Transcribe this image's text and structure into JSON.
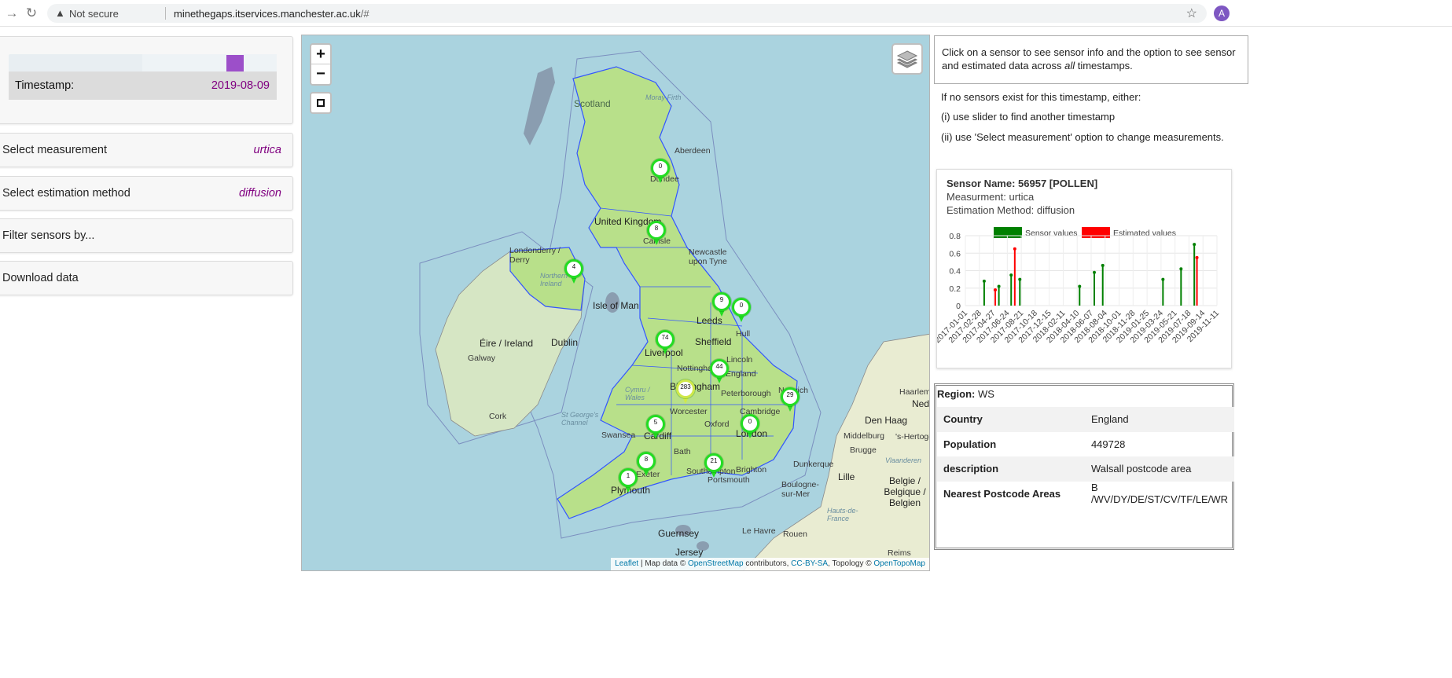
{
  "browser": {
    "security_label": "Not secure",
    "url_host": "minethegaps.itservices.manchester.ac.uk",
    "url_path": "/#",
    "profile_initial": "A"
  },
  "controls": {
    "timestamp_label": "Timestamp:",
    "timestamp_value": "2019-08-09",
    "measurement_label": "Select measurement",
    "measurement_value": "urtica",
    "estimation_label": "Select estimation method",
    "estimation_value": "diffusion",
    "filter_label": "Filter sensors by...",
    "download_label": "Download data",
    "accent_color": "#9c4fc9"
  },
  "map": {
    "zoom_in": "+",
    "zoom_out": "−",
    "attribution": {
      "leaflet": "Leaflet",
      "map_data": " | Map data © ",
      "osm": "OpenStreetMap",
      "contributors": " contributors, ",
      "license": "CC-BY-SA",
      "topology": ", Topology © ",
      "opentopo": "OpenTopoMap"
    },
    "labels": {
      "scotland": "Scotland",
      "moray": "Moray Firth",
      "aberdeen": "Aberdeen",
      "dundee": "Dundee",
      "uk": "United Kingdom",
      "londonderry": "Londonderry / Derry",
      "ni": "Northern Ireland",
      "newcastle": "Newcastle upon Tyne",
      "carlisle": "Carlisle",
      "isle_of_man": "Isle of Man",
      "leeds": "Leeds",
      "hull": "Hull",
      "sheffield": "Sheffield",
      "liverpool": "Liverpool",
      "eire": "Éire / Ireland",
      "dublin": "Dublin",
      "galway": "Galway",
      "nottingham": "Nottingham",
      "lincoln": "Lincoln",
      "birmingham": "Birmingham",
      "peterborough": "Peterborough",
      "cymru": "Cymru / Wales",
      "cork": "Cork",
      "worcester": "Worcester",
      "cambridge": "Cambridge",
      "norwich": "Norwich",
      "stgeorge": "St George's Channel",
      "swansea": "Swansea",
      "cardiff": "Cardiff",
      "oxford": "Oxford",
      "london": "London",
      "bath": "Bath",
      "exeter": "Exeter",
      "southampton": "Southampton",
      "portsmouth": "Portsmouth",
      "brighton": "Brighton",
      "plymouth": "Plymouth",
      "england": "England",
      "haarlem": "Haarlem",
      "nederland": "Nederland",
      "denhaag": "Den Haag",
      "hertogenbosch": "'s-Hertogenbosch",
      "middelburg": "Middelburg",
      "brugge": "Brugge",
      "vlaanderen": "Vlaanderen",
      "dunkerque": "Dunkerque",
      "lille": "Lille",
      "belgie": "Belgie / Belgique / Belgien",
      "boulogne": "Boulogne-sur-Mer",
      "hautsdefrance": "Hauts-de-France",
      "lehavre": "Le Havre",
      "rouen": "Rouen",
      "reims": "Reims",
      "guernsey": "Guernsey",
      "jersey": "Jersey"
    },
    "markers": [
      {
        "count": "0",
        "color": "green"
      },
      {
        "count": "8",
        "color": "green"
      },
      {
        "count": "4",
        "color": "green"
      },
      {
        "count": "9",
        "color": "green"
      },
      {
        "count": "0",
        "color": "green"
      },
      {
        "count": "74",
        "color": "green"
      },
      {
        "count": "44",
        "color": "green"
      },
      {
        "count": "283",
        "color": "yellow"
      },
      {
        "count": "29",
        "color": "green"
      },
      {
        "count": "5",
        "color": "green"
      },
      {
        "count": "0",
        "color": "green"
      },
      {
        "count": "8",
        "color": "green"
      },
      {
        "count": "21",
        "color": "green"
      },
      {
        "count": "1",
        "color": "green"
      }
    ]
  },
  "info": {
    "intro_pre": "Click on a sensor to see sensor info and the option to see sensor and estimated data across ",
    "intro_em": "all",
    "intro_post": " timestamps.",
    "hint1": "If no sensors exist for this timestamp, either:",
    "hint2": "(i) use slider to find another timestamp",
    "hint3": "(ii) use 'Select measurement' option to change measurements."
  },
  "sensor": {
    "name": "Sensor Name: 56957 [POLLEN]",
    "measurement": "Measurment: urtica",
    "estimation": "Estimation Method: diffusion"
  },
  "chart_data": {
    "type": "bar",
    "series": [
      {
        "name": "Sensor values",
        "color": "#008000"
      },
      {
        "name": "Estimated values",
        "color": "#ff0000"
      }
    ],
    "ylim": [
      0,
      0.8
    ],
    "yticks": [
      "0.8",
      "0.6",
      "0.4",
      "0.2",
      "0"
    ],
    "xticks": [
      "2017-01-01",
      "2017-02-28",
      "2017-04-27",
      "2017-06-24",
      "2017-08-21",
      "2017-10-18",
      "2017-12-15",
      "2018-02-11",
      "2018-04-10",
      "2018-06-07",
      "2018-08-04",
      "2018-10-01",
      "2018-11-28",
      "2019-01-25",
      "2019-03-24",
      "2019-05-21",
      "2019-07-18",
      "2019-09-14",
      "2019-11-11"
    ],
    "peaks_note": "",
    "sensor_peaks": [
      {
        "x": "2017-03-20",
        "y": 0.28
      },
      {
        "x": "2017-05-20",
        "y": 0.22
      },
      {
        "x": "2017-07-10",
        "y": 0.35
      },
      {
        "x": "2017-08-15",
        "y": 0.3
      },
      {
        "x": "2018-04-20",
        "y": 0.22
      },
      {
        "x": "2018-06-20",
        "y": 0.38
      },
      {
        "x": "2018-07-25",
        "y": 0.46
      },
      {
        "x": "2019-04-01",
        "y": 0.3
      },
      {
        "x": "2019-06-15",
        "y": 0.42
      },
      {
        "x": "2019-08-09",
        "y": 0.7
      }
    ],
    "estimated_peaks": [
      {
        "x": "2017-07-25",
        "y": 0.65
      },
      {
        "x": "2017-05-05",
        "y": 0.18
      },
      {
        "x": "2019-08-20",
        "y": 0.55
      }
    ]
  },
  "region": {
    "title_label": "Region:",
    "title_value": "WS",
    "rows": [
      {
        "k": "Country",
        "v": "England"
      },
      {
        "k": "Population",
        "v": "449728"
      },
      {
        "k": "description",
        "v": "Walsall postcode area"
      },
      {
        "k": "Nearest Postcode Areas",
        "v": "B /WV/DY/DE/ST/CV/TF/LE/WR"
      }
    ]
  }
}
